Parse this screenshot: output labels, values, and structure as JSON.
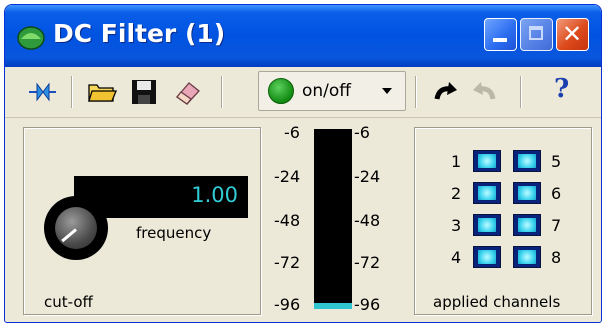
{
  "window": {
    "title": "DC Filter (1)"
  },
  "toolbar": {
    "onoff_label": "on/off",
    "icons": [
      "pin-icon",
      "folder-open-icon",
      "save-icon",
      "eraser-icon",
      "power-icon",
      "undo-icon",
      "redo-icon",
      "help-icon"
    ],
    "help_label": "?"
  },
  "cutoff": {
    "frequency_value": "1.00",
    "frequency_label": "frequency",
    "panel_label": "cut-off",
    "knob_level": 0
  },
  "meter": {
    "left_labels": [
      "-6",
      "-24",
      "-48",
      "-72",
      "-96"
    ],
    "right_labels": [
      "-6",
      "-24",
      "-48",
      "-72",
      "-96"
    ],
    "level_db": -96
  },
  "channels": {
    "label": "applied channels",
    "items": [
      {
        "number": "1",
        "on": true
      },
      {
        "number": "2",
        "on": true
      },
      {
        "number": "3",
        "on": true
      },
      {
        "number": "4",
        "on": true
      },
      {
        "number": "5",
        "on": true
      },
      {
        "number": "6",
        "on": true
      },
      {
        "number": "7",
        "on": true
      },
      {
        "number": "8",
        "on": true
      }
    ]
  },
  "colors": {
    "title_bar": "#0053e1",
    "display_text": "#32ccd6",
    "led_on": "#3bd3ee",
    "window_bg": "#ece9d8"
  }
}
